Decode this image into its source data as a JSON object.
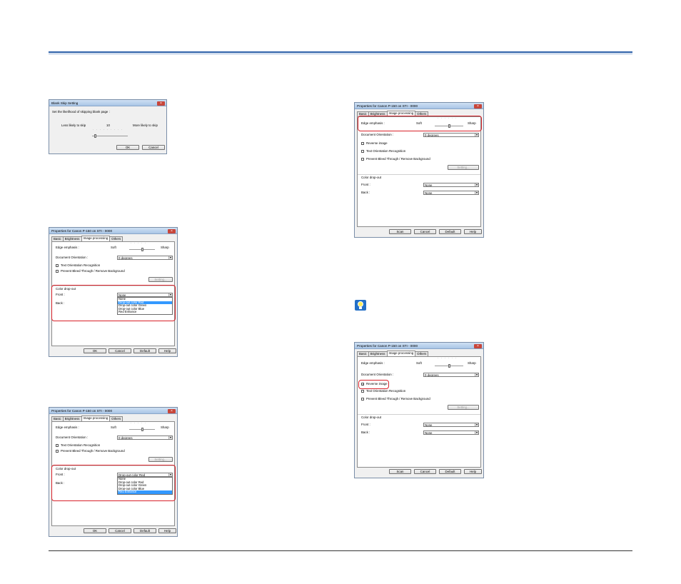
{
  "blank_skip": {
    "title": "Blank Skip Setting",
    "prompt": "Set the likelihood of skipping blank page :",
    "less": "Less likely to skip",
    "value": "10",
    "more": "More likely to skip",
    "ok": "OK",
    "cancel": "Cancel"
  },
  "dialog_common": {
    "title": "Properties for Canon P-150 on STI - 0000",
    "tab_basic": "Basic",
    "tab_brightness": "Brightness",
    "tab_image": "Image processing",
    "tab_others": "Others",
    "edge_label": "Edge emphasis :",
    "soft": "Soft",
    "sharp": "Sharp",
    "orientation_label": "Document Orientation :",
    "orientation_value": "0 degrees",
    "reverse": "Reverse image",
    "text_orientation": "Text Orientation Recognition",
    "bleed": "Prevent Bleed Through / Remove Background",
    "setting": "Setting...",
    "dropout_group": "Color drop-out",
    "front": "Front :",
    "back": "Back :",
    "none": "None",
    "scan": "Scan",
    "ok": "OK",
    "cancel": "Cancel",
    "default": "Default",
    "help": "Help"
  },
  "dropout_options": [
    "None",
    "Drop-out color Red",
    "Drop-out color Green",
    "Drop-out color Blue",
    "Red Enhance"
  ],
  "dialog_b": {
    "front_value": "None",
    "selected_index": 1
  },
  "dialog_c": {
    "front_value": "Drop-out color Red",
    "selected_index": 4
  },
  "colors": {
    "highlight": "#d8222a",
    "rule": "#2b5fa8",
    "selection": "#3399ff"
  }
}
